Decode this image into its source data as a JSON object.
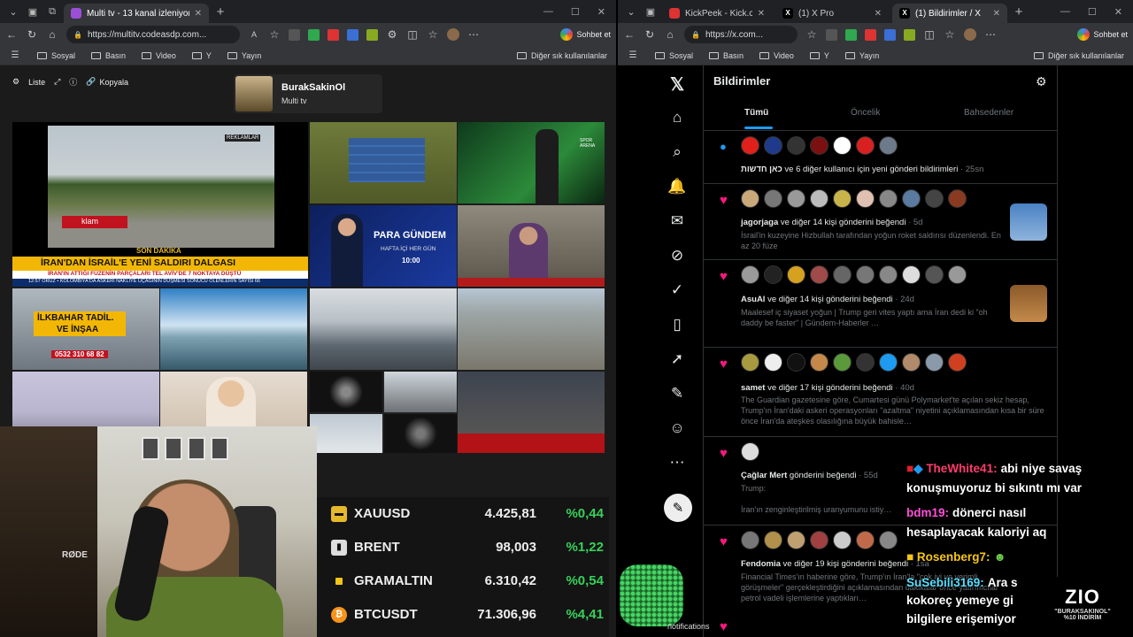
{
  "left_browser": {
    "tab_title": "Multi tv - 13 kanal izleniyor",
    "url": "https://multitv.codeasdp.com...",
    "chat_button": "Sohbet et",
    "bookmarks": [
      "Sosyal",
      "Basın",
      "Video",
      "Y",
      "Yayın"
    ],
    "bookmarks_other": "Diğer sık kullanılanlar"
  },
  "right_browser": {
    "tabs": [
      "KickPeek - Kick.com için C",
      "(1) X Pro",
      "(1) Bildirimler / X"
    ],
    "url": "https://x.com...",
    "chat_button": "Sohbet et",
    "bookmarks": [
      "Sosyal",
      "Basın",
      "Video",
      "Y",
      "Yayın"
    ],
    "bookmarks_other": "Diğer sık kullanılanlar"
  },
  "multitv": {
    "toolbar": {
      "list": "Liste",
      "copy": "Kopyala"
    },
    "profile": {
      "name": "BurakSakinOl",
      "subtitle": "Multi tv"
    },
    "tiles": {
      "reklam": "REKLAMLAR",
      "ad_text": "klam",
      "son_dakika": "SON DAKİKA",
      "headline": "İRAN'DAN İSRAİL'E YENİ SALDIRI DALGASI",
      "subhead": "İRAN'IN ATTIĞI FÜZENİN PARÇALARI TEL AVİV'DE 7 NOKTAYA DÜŞTÜ",
      "crawl": "12:57 ORUZ  •  KOLOMBİYA'DA ASKERİ NAKLİYE UÇAĞININ DÜŞMESİ SONUCU ÖLENLERİN SAYISI 66",
      "para_title": "PARA GÜNDEM",
      "para_sub": "HAFTA İÇİ HER GÜN",
      "para_time": "10:00",
      "ilkbahar": "İLKBAHAR TADİL.",
      "insaa": "VE İNŞAA",
      "phone": "0532 310 68 82",
      "spor": "SPOR ARENA"
    }
  },
  "ticker": [
    {
      "name": "XAUUSD",
      "price": "4.425,81",
      "change": "%0,44",
      "icon_color": "#e5b82c"
    },
    {
      "name": "BRENT",
      "price": "98,003",
      "change": "%1,22",
      "icon_color": "#dddddd"
    },
    {
      "name": "GRAMALTIN",
      "price": "6.310,42",
      "change": "%0,54",
      "icon_color": "#f5c518"
    },
    {
      "name": "BTCUSDT",
      "price": "71.306,96",
      "change": "%4,41",
      "icon_color": "#f7931a"
    }
  ],
  "webcam": {
    "mic_brand": "RØDE"
  },
  "x": {
    "header": "Bildirimler",
    "tabs": [
      "Tümü",
      "Öncelik",
      "Bahsedenler"
    ],
    "notifications": [
      {
        "user": "כאן חדשות",
        "text": "ve 6 diğer kullanıcı için yeni gönderi bildirimleri",
        "time": "25sn",
        "body": ""
      },
      {
        "user": "jagorjaga",
        "text": "ve diğer 14 kişi gönderini beğendi",
        "time": "5d",
        "body": "İsrail'in kuzeyine Hizbullah tarafından yoğun roket saldırısı düzenlendi. En az 20 füze"
      },
      {
        "user": "AsuAl",
        "text": "ve diğer 14 kişi gönderini beğendi",
        "time": "24d",
        "body": "Maalesef iç siyaset yoğun | Trump geri vites yaptı ama İran dedi ki \"oh daddy be faster\" | Gündem-Haberler …"
      },
      {
        "user": "samet",
        "text": "ve diğer 17 kişi gönderini beğendi",
        "time": "40d",
        "body": "The Guardian gazetesine göre, Cumartesi günü Polymarket'te açılan sekiz hesap, Trump'ın İran'daki askeri operasyonları \"azaltma\" niyetini açıklamasından kısa bir süre önce İran'da ateşkes olasılığına büyük bahisle…"
      },
      {
        "user": "Çağlar Mert",
        "text": "gönderini beğendi",
        "time": "55d",
        "body": "Trump:\n\nİran'ın zenginleştirilmiş uranyumunu istiy…"
      },
      {
        "user": "Fendomia",
        "text": "ve diğer 19 kişi gönderini beğendi",
        "time": "1sa",
        "body": "Financial Times'ın haberine göre, Trump'ın İran'la \"çok iyi ve verimli görüşmeler\" gerçekleştirdiğini açıklamasından dakikalar önce yatırımcılar petrol vadeli işlemlerine yaptıkları…"
      }
    ]
  },
  "stream_chat": [
    {
      "user": "TheWhite41:",
      "msg": "abi niye savaş",
      "color": "#ff3b6b"
    },
    {
      "user": "",
      "msg": "konuşmuyoruz bi sıkıntı mı var",
      "color": "#ffffff"
    },
    {
      "user": "bdm19:",
      "msg": "dönerci nasıl",
      "color": "#ff4fd8"
    },
    {
      "user": "",
      "msg": "hesaplayacak kaloriyi aq",
      "color": "#ffffff"
    },
    {
      "user": "Rosenberg7:",
      "msg": "",
      "color": "#f5c518"
    },
    {
      "user": "SuSebili3169:",
      "msg": "Ara s",
      "color": "#58e0ff"
    },
    {
      "user": "",
      "msg": "kokoreç yemeye gi",
      "color": "#ffffff"
    },
    {
      "user": "",
      "msg": "bilgilere erişemiyor",
      "color": "#ffffff"
    }
  ],
  "brand": {
    "logo": "ZIO",
    "line1": "\"BURAKSAKINOL\"",
    "line2": "%10 İNDİRİM"
  },
  "overlay_notifications": "notifications"
}
